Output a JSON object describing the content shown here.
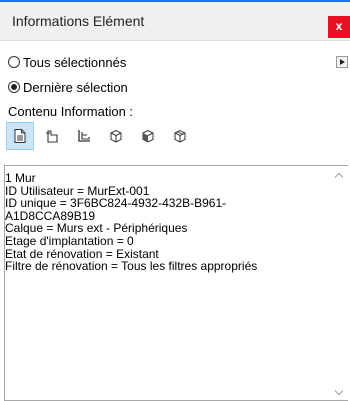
{
  "window": {
    "title": "Informations Elément",
    "close_label": "x"
  },
  "selection": {
    "options": [
      {
        "label": "Tous sélectionnés",
        "checked": false
      },
      {
        "label": "Dernière sélection",
        "checked": true
      }
    ]
  },
  "content": {
    "section_label": "Contenu Information :",
    "tools": [
      {
        "icon": "document-icon",
        "active": true
      },
      {
        "icon": "plan-element-icon",
        "active": false
      },
      {
        "icon": "section-element-icon",
        "active": false
      },
      {
        "icon": "3d-box-icon",
        "active": false
      },
      {
        "icon": "3d-box-filled-icon",
        "active": false
      },
      {
        "icon": "3d-box-open-icon",
        "active": false
      }
    ]
  },
  "info": {
    "lines": [
      "1 Mur",
      "ID Utilisateur = MurExt-001",
      "ID unique = 3F6BC824-4932-432B-B961-",
      "A1D8CCA89B19",
      "Calque =  Murs ext - Périphériques",
      "Etage d'implantation = 0",
      "Etat de rénovation = Existant",
      "Filtre de rénovation = Tous les filtres appropriés"
    ]
  },
  "colors": {
    "accent_line": "#1a73e8",
    "close": "#e81123",
    "tool_active": "#cce4f7"
  }
}
